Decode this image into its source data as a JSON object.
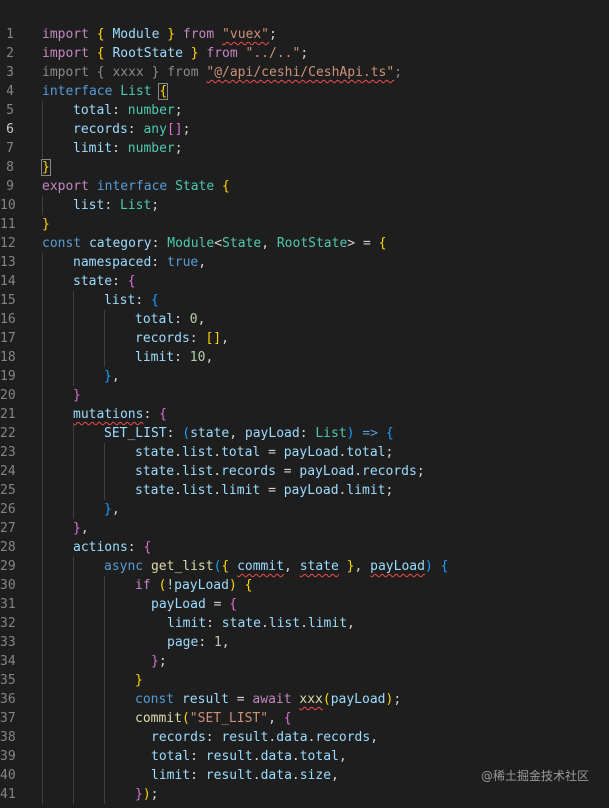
{
  "theme": {
    "background": "#1e1e1e",
    "line_number": "#858585",
    "indent_guide": "#404040",
    "colors": {
      "kw": "#c586c0",
      "kw2": "#569cd6",
      "str": "#ce9178",
      "var": "#9cdcfe",
      "type": "#4ec9b0",
      "num": "#b5cea8",
      "fn": "#dcdcaa",
      "plain": "#d4d4d4",
      "dim": "#8a8a8a",
      "b1": "#ffd700",
      "b2": "#da70d6",
      "b3": "#179fff"
    }
  },
  "editor": {
    "active_line": 6,
    "lines": [
      {
        "n": "1",
        "tokens": [
          [
            "import ",
            "kw"
          ],
          [
            "{",
            "b1"
          ],
          [
            " Module ",
            "var"
          ],
          [
            "}",
            "b1"
          ],
          [
            " from ",
            "kw"
          ],
          [
            "\"vuex\"",
            "str",
            "sq"
          ],
          [
            ";",
            "plain"
          ]
        ]
      },
      {
        "n": "2",
        "tokens": [
          [
            "import ",
            "kw"
          ],
          [
            "{",
            "b1"
          ],
          [
            " RootState ",
            "var"
          ],
          [
            "}",
            "b1"
          ],
          [
            " from ",
            "kw"
          ],
          [
            "\"../..\"",
            "str"
          ],
          [
            ";",
            "plain"
          ]
        ]
      },
      {
        "n": "3",
        "tokens": [
          [
            "import { xxxx } from ",
            "dim"
          ],
          [
            "\"@/api/ceshi/CeshApi.ts\"",
            "str",
            "sq"
          ],
          [
            ";",
            "dim"
          ]
        ]
      },
      {
        "n": "4",
        "tokens": [
          [
            "interface ",
            "kw2"
          ],
          [
            "List ",
            "type"
          ],
          [
            "{",
            "b1",
            "box"
          ]
        ]
      },
      {
        "n": "5",
        "indent": 1,
        "tokens": [
          [
            "total",
            "var"
          ],
          [
            ": ",
            "plain"
          ],
          [
            "number",
            "type"
          ],
          [
            ";",
            "plain"
          ]
        ]
      },
      {
        "n": "6",
        "indent": 1,
        "tokens": [
          [
            "records",
            "var"
          ],
          [
            ": ",
            "plain"
          ],
          [
            "any",
            "type"
          ],
          [
            "[]",
            "b2"
          ],
          [
            ";",
            "plain"
          ]
        ]
      },
      {
        "n": "7",
        "indent": 1,
        "tokens": [
          [
            "limit",
            "var"
          ],
          [
            ": ",
            "plain"
          ],
          [
            "number",
            "type"
          ],
          [
            ";",
            "plain"
          ]
        ]
      },
      {
        "n": "8",
        "tokens": [
          [
            "}",
            "b1",
            "box"
          ]
        ]
      },
      {
        "n": "9",
        "tokens": [
          [
            "export ",
            "kw"
          ],
          [
            "interface ",
            "kw2"
          ],
          [
            "State ",
            "type"
          ],
          [
            "{",
            "b1"
          ]
        ]
      },
      {
        "n": "10",
        "indent": 1,
        "tokens": [
          [
            "list",
            "var"
          ],
          [
            ": ",
            "plain"
          ],
          [
            "List",
            "type"
          ],
          [
            ";",
            "plain"
          ]
        ]
      },
      {
        "n": "11",
        "tokens": [
          [
            "}",
            "b1"
          ]
        ]
      },
      {
        "n": "12",
        "tokens": [
          [
            "const ",
            "kw2"
          ],
          [
            "category",
            "var"
          ],
          [
            ": ",
            "plain"
          ],
          [
            "Module",
            "type"
          ],
          [
            "<",
            "plain"
          ],
          [
            "State",
            "type"
          ],
          [
            ", ",
            "plain"
          ],
          [
            "RootState",
            "type"
          ],
          [
            "> = ",
            "plain"
          ],
          [
            "{",
            "b1"
          ]
        ]
      },
      {
        "n": "13",
        "indent": 1,
        "tokens": [
          [
            "namespaced",
            "var"
          ],
          [
            ": ",
            "plain"
          ],
          [
            "true",
            "kw2"
          ],
          [
            ",",
            "plain"
          ]
        ]
      },
      {
        "n": "14",
        "indent": 1,
        "tokens": [
          [
            "state",
            "var"
          ],
          [
            ": ",
            "plain"
          ],
          [
            "{",
            "b2"
          ]
        ]
      },
      {
        "n": "15",
        "indent": 2,
        "tokens": [
          [
            "list",
            "var"
          ],
          [
            ": ",
            "plain"
          ],
          [
            "{",
            "b3"
          ]
        ]
      },
      {
        "n": "16",
        "indent": 3,
        "tokens": [
          [
            "total",
            "var"
          ],
          [
            ": ",
            "plain"
          ],
          [
            "0",
            "num"
          ],
          [
            ",",
            "plain"
          ]
        ]
      },
      {
        "n": "17",
        "indent": 3,
        "tokens": [
          [
            "records",
            "var"
          ],
          [
            ": ",
            "plain"
          ],
          [
            "[]",
            "b1"
          ],
          [
            ",",
            "plain"
          ]
        ]
      },
      {
        "n": "18",
        "indent": 3,
        "tokens": [
          [
            "limit",
            "var"
          ],
          [
            ": ",
            "plain"
          ],
          [
            "10",
            "num"
          ],
          [
            ",",
            "plain"
          ]
        ]
      },
      {
        "n": "19",
        "indent": 2,
        "tokens": [
          [
            "}",
            "b3"
          ],
          [
            ",",
            "plain"
          ]
        ]
      },
      {
        "n": "20",
        "indent": 1,
        "tokens": [
          [
            "}",
            "b2"
          ]
        ]
      },
      {
        "n": "21",
        "indent": 1,
        "tokens": [
          [
            "mutations",
            "var",
            "sq"
          ],
          [
            ": ",
            "plain"
          ],
          [
            "{",
            "b2"
          ]
        ]
      },
      {
        "n": "22",
        "indent": 2,
        "tokens": [
          [
            "SET_LIST",
            "var"
          ],
          [
            ": ",
            "plain"
          ],
          [
            "(",
            "b3"
          ],
          [
            "state",
            "var"
          ],
          [
            ", ",
            "plain"
          ],
          [
            "payLoad",
            "var"
          ],
          [
            ": ",
            "plain"
          ],
          [
            "List",
            "type"
          ],
          [
            ")",
            "b3"
          ],
          [
            " => ",
            "kw2"
          ],
          [
            "{",
            "b3"
          ]
        ]
      },
      {
        "n": "23",
        "indent": 3,
        "tokens": [
          [
            "state",
            "var"
          ],
          [
            ".",
            "plain"
          ],
          [
            "list",
            "var"
          ],
          [
            ".",
            "plain"
          ],
          [
            "total",
            "var"
          ],
          [
            " = ",
            "plain"
          ],
          [
            "payLoad",
            "var"
          ],
          [
            ".",
            "plain"
          ],
          [
            "total",
            "var"
          ],
          [
            ";",
            "plain"
          ]
        ]
      },
      {
        "n": "24",
        "indent": 3,
        "tokens": [
          [
            "state",
            "var"
          ],
          [
            ".",
            "plain"
          ],
          [
            "list",
            "var"
          ],
          [
            ".",
            "plain"
          ],
          [
            "records",
            "var"
          ],
          [
            " = ",
            "plain"
          ],
          [
            "payLoad",
            "var"
          ],
          [
            ".",
            "plain"
          ],
          [
            "records",
            "var"
          ],
          [
            ";",
            "plain"
          ]
        ]
      },
      {
        "n": "25",
        "indent": 3,
        "tokens": [
          [
            "state",
            "var"
          ],
          [
            ".",
            "plain"
          ],
          [
            "list",
            "var"
          ],
          [
            ".",
            "plain"
          ],
          [
            "limit",
            "var"
          ],
          [
            " = ",
            "plain"
          ],
          [
            "payLoad",
            "var"
          ],
          [
            ".",
            "plain"
          ],
          [
            "limit",
            "var"
          ],
          [
            ";",
            "plain"
          ]
        ]
      },
      {
        "n": "26",
        "indent": 2,
        "tokens": [
          [
            "}",
            "b3"
          ],
          [
            ",",
            "plain"
          ]
        ]
      },
      {
        "n": "27",
        "indent": 1,
        "tokens": [
          [
            "}",
            "b2"
          ],
          [
            ",",
            "plain"
          ]
        ]
      },
      {
        "n": "28",
        "indent": 1,
        "tokens": [
          [
            "actions",
            "var"
          ],
          [
            ": ",
            "plain"
          ],
          [
            "{",
            "b2"
          ]
        ]
      },
      {
        "n": "29",
        "indent": 2,
        "tokens": [
          [
            "async ",
            "kw2"
          ],
          [
            "get_list",
            "fn"
          ],
          [
            "(",
            "b3"
          ],
          [
            "{",
            "b1"
          ],
          [
            " ",
            "plain"
          ],
          [
            "commit",
            "var",
            "sq"
          ],
          [
            ", ",
            "plain"
          ],
          [
            "state",
            "var",
            "sq"
          ],
          [
            " ",
            "plain"
          ],
          [
            "}",
            "b1"
          ],
          [
            ", ",
            "plain"
          ],
          [
            "payLoad",
            "var",
            "sq"
          ],
          [
            ")",
            "b3"
          ],
          [
            " ",
            "plain"
          ],
          [
            "{",
            "b3"
          ]
        ]
      },
      {
        "n": "30",
        "indent": 3,
        "tokens": [
          [
            "if ",
            "kw"
          ],
          [
            "(",
            "b1"
          ],
          [
            "!",
            "plain"
          ],
          [
            "payLoad",
            "var"
          ],
          [
            ")",
            "b1"
          ],
          [
            " ",
            "plain"
          ],
          [
            "{",
            "b1"
          ]
        ]
      },
      {
        "n": "31",
        "indent": 3,
        "extra": 16,
        "tokens": [
          [
            "payLoad",
            "var"
          ],
          [
            " = ",
            "plain"
          ],
          [
            "{",
            "b2"
          ]
        ]
      },
      {
        "n": "32",
        "indent": 3,
        "extra": 32,
        "tokens": [
          [
            "limit",
            "var"
          ],
          [
            ": ",
            "plain"
          ],
          [
            "state",
            "var"
          ],
          [
            ".",
            "plain"
          ],
          [
            "list",
            "var"
          ],
          [
            ".",
            "plain"
          ],
          [
            "limit",
            "var"
          ],
          [
            ",",
            "plain"
          ]
        ]
      },
      {
        "n": "33",
        "indent": 3,
        "extra": 32,
        "tokens": [
          [
            "page",
            "var"
          ],
          [
            ": ",
            "plain"
          ],
          [
            "1",
            "num"
          ],
          [
            ",",
            "plain"
          ]
        ]
      },
      {
        "n": "34",
        "indent": 3,
        "extra": 16,
        "tokens": [
          [
            "}",
            "b2"
          ],
          [
            ";",
            "plain"
          ]
        ]
      },
      {
        "n": "35",
        "indent": 3,
        "tokens": [
          [
            "}",
            "b1"
          ]
        ]
      },
      {
        "n": "36",
        "indent": 3,
        "tokens": [
          [
            "const ",
            "kw2"
          ],
          [
            "result",
            "var"
          ],
          [
            " = ",
            "plain"
          ],
          [
            "await ",
            "kw"
          ],
          [
            "xxx",
            "fn",
            "sq"
          ],
          [
            "(",
            "b1"
          ],
          [
            "payLoad",
            "var"
          ],
          [
            ")",
            "b1"
          ],
          [
            ";",
            "plain"
          ]
        ]
      },
      {
        "n": "37",
        "indent": 3,
        "tokens": [
          [
            "commit",
            "fn"
          ],
          [
            "(",
            "b1"
          ],
          [
            "\"SET_LIST\"",
            "str"
          ],
          [
            ", ",
            "plain"
          ],
          [
            "{",
            "b2"
          ]
        ]
      },
      {
        "n": "38",
        "indent": 3,
        "extra": 16,
        "tokens": [
          [
            "records",
            "var"
          ],
          [
            ": ",
            "plain"
          ],
          [
            "result",
            "var"
          ],
          [
            ".",
            "plain"
          ],
          [
            "data",
            "var"
          ],
          [
            ".",
            "plain"
          ],
          [
            "records",
            "var"
          ],
          [
            ",",
            "plain"
          ]
        ]
      },
      {
        "n": "39",
        "indent": 3,
        "extra": 16,
        "tokens": [
          [
            "total",
            "var"
          ],
          [
            ": ",
            "plain"
          ],
          [
            "result",
            "var"
          ],
          [
            ".",
            "plain"
          ],
          [
            "data",
            "var"
          ],
          [
            ".",
            "plain"
          ],
          [
            "total",
            "var"
          ],
          [
            ",",
            "plain"
          ]
        ]
      },
      {
        "n": "40",
        "indent": 3,
        "extra": 16,
        "tokens": [
          [
            "limit",
            "var"
          ],
          [
            ": ",
            "plain"
          ],
          [
            "result",
            "var"
          ],
          [
            ".",
            "plain"
          ],
          [
            "data",
            "var"
          ],
          [
            ".",
            "plain"
          ],
          [
            "size",
            "var"
          ],
          [
            ",",
            "plain"
          ]
        ]
      },
      {
        "n": "41",
        "indent": 3,
        "tokens": [
          [
            "}",
            "b2"
          ],
          [
            ")",
            "b1"
          ],
          [
            ";",
            "plain"
          ]
        ]
      }
    ]
  },
  "watermark": "@稀土掘金技术社区"
}
